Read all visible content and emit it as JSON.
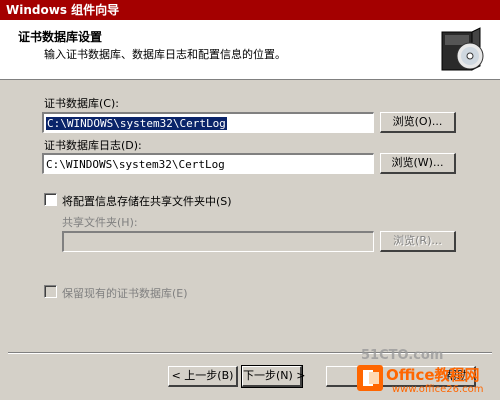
{
  "window": {
    "title": "Windows 组件向导"
  },
  "header": {
    "title": "证书数据库设置",
    "subtitle": "输入证书数据库、数据库日志和配置信息的位置。",
    "icon": "cd-box-icon"
  },
  "form": {
    "db_label": "证书数据库(C):",
    "db_value": "C:\\WINDOWS\\system32\\CertLog",
    "db_browse": "浏览(O)...",
    "log_label": "证书数据库日志(D):",
    "log_value": "C:\\WINDOWS\\system32\\CertLog",
    "log_browse": "浏览(W)...",
    "shared_checkbox_label": "将配置信息存储在共享文件夹中(S)",
    "shared_folder_label": "共享文件夹(H):",
    "shared_folder_value": "",
    "shared_browse": "浏览(R)...",
    "preserve_checkbox_label": "保留现有的证书数据库(E)"
  },
  "buttons": {
    "back": "< 上一步(B)",
    "next": "下一步(N) >",
    "help": "帮助"
  },
  "watermark": {
    "site": "51CTO.com",
    "brand": "Office教程网",
    "url": "www.office26.com"
  },
  "colors": {
    "titlebar": "#a40000",
    "selection": "#0a246a",
    "brand_orange": "#ff6600"
  }
}
